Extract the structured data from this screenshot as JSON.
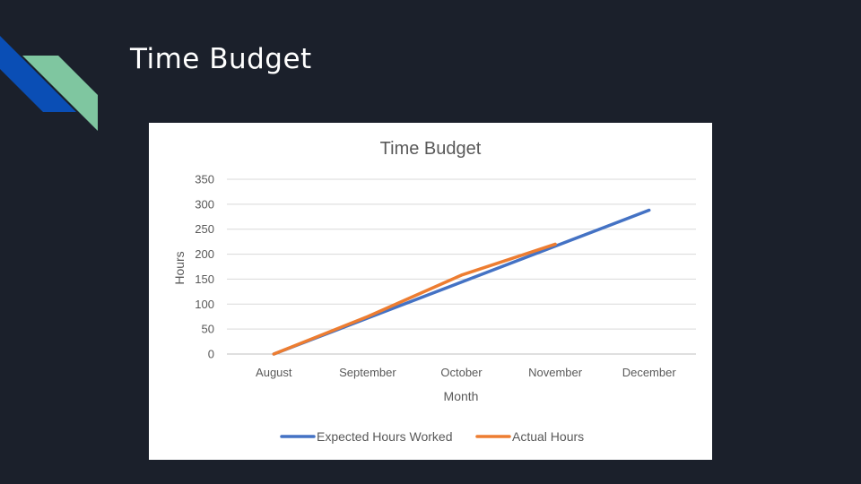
{
  "slide": {
    "title": "Time Budget",
    "accent_colors": [
      "#0a4eb5",
      "#7fc6a0"
    ]
  },
  "chart_data": {
    "type": "line",
    "title": "Time Budget",
    "xlabel": "Month",
    "ylabel": "Hours",
    "categories": [
      "August",
      "September",
      "October",
      "November",
      "December"
    ],
    "ylim": [
      0,
      350
    ],
    "yticks": [
      0,
      50,
      100,
      150,
      200,
      250,
      300,
      350
    ],
    "grid": true,
    "legend_position": "bottom",
    "series": [
      {
        "name": "Expected Hours Worked",
        "color": "#4472c4",
        "values": [
          0,
          72,
          144,
          216,
          288
        ]
      },
      {
        "name": "Actual Hours",
        "color": "#ed7d31",
        "values": [
          0,
          75,
          158,
          220,
          null
        ]
      }
    ]
  }
}
